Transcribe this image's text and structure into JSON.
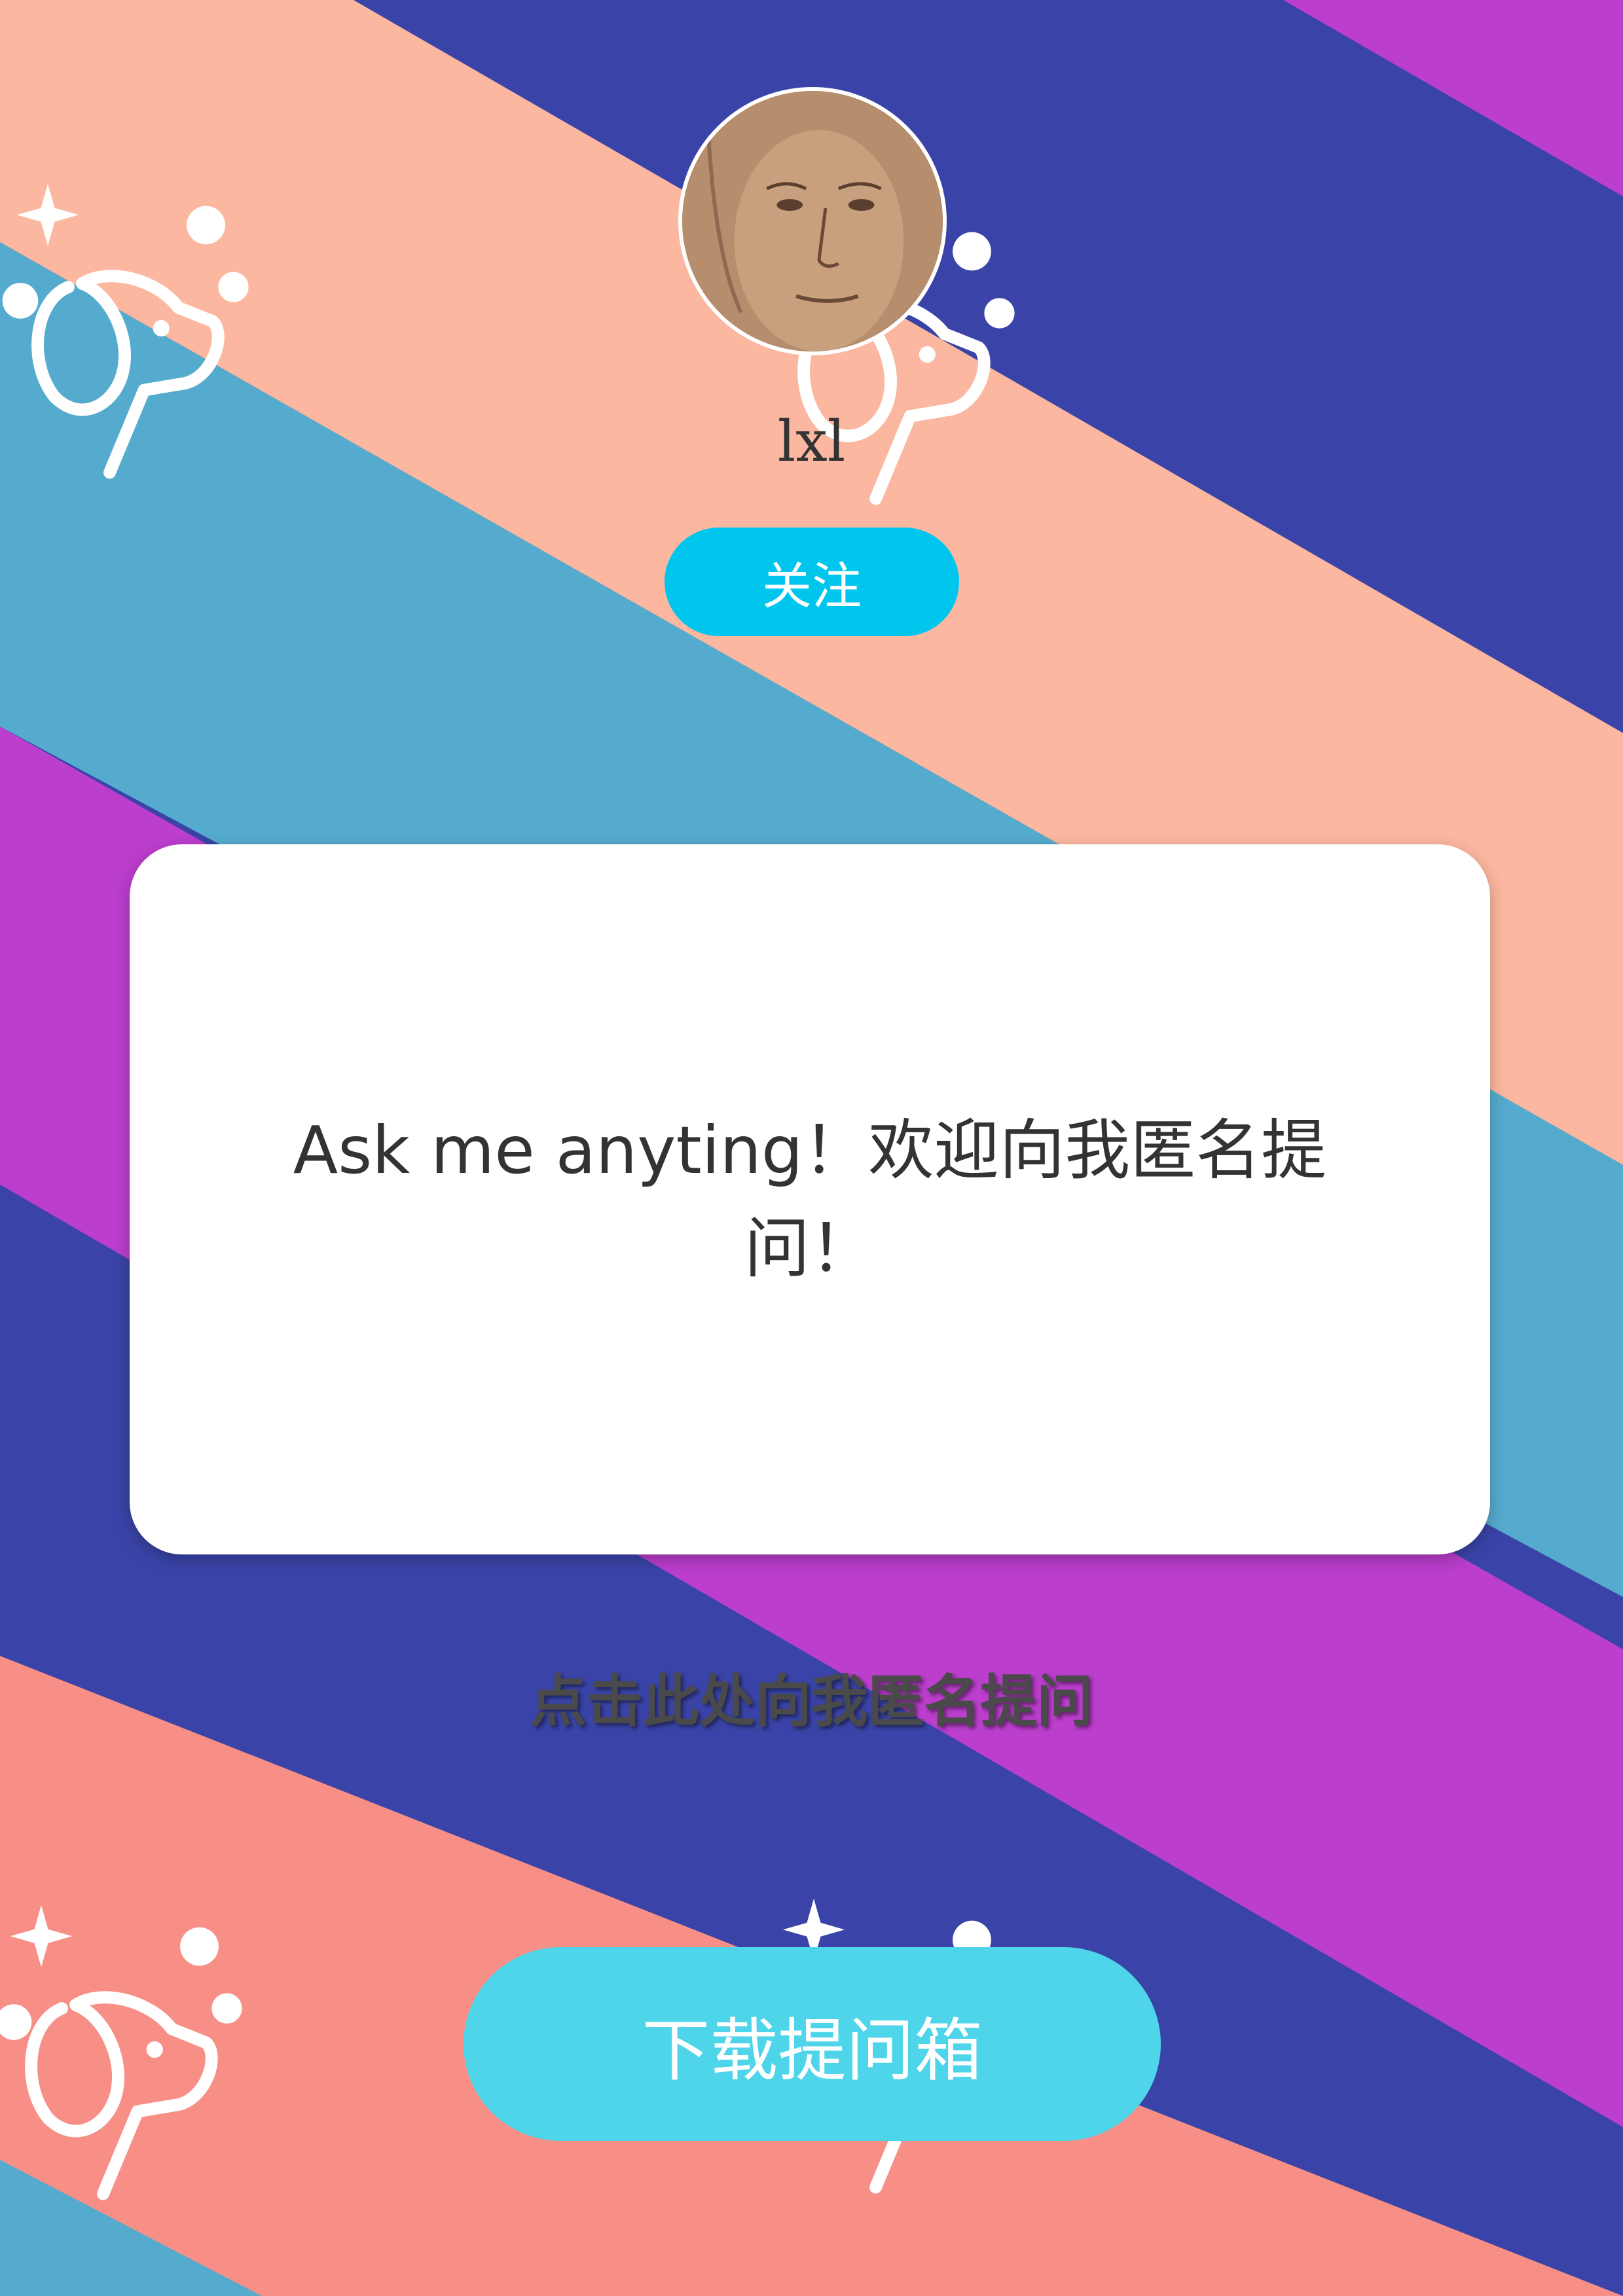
{
  "profile": {
    "username": "lxl",
    "follow_label": "关注"
  },
  "card": {
    "message": "Ask me anyting！欢迎向我匿名提问！"
  },
  "actions": {
    "ask_anonymous_label": "点击此处向我匿名提问",
    "download_label": "下载提问箱"
  },
  "colors": {
    "stripe_peach": "#fbb79f",
    "stripe_navy": "#3a44a8",
    "stripe_purple": "#bb3ecd",
    "stripe_teal": "#55abcd",
    "stripe_salmon": "#f88f87",
    "follow_button": "#00c6ee",
    "download_button": "#4ed5e9",
    "card": "#ffffff"
  },
  "icons": {
    "background_decoration": "dog-sparkle-icon",
    "avatar": "user-avatar"
  }
}
